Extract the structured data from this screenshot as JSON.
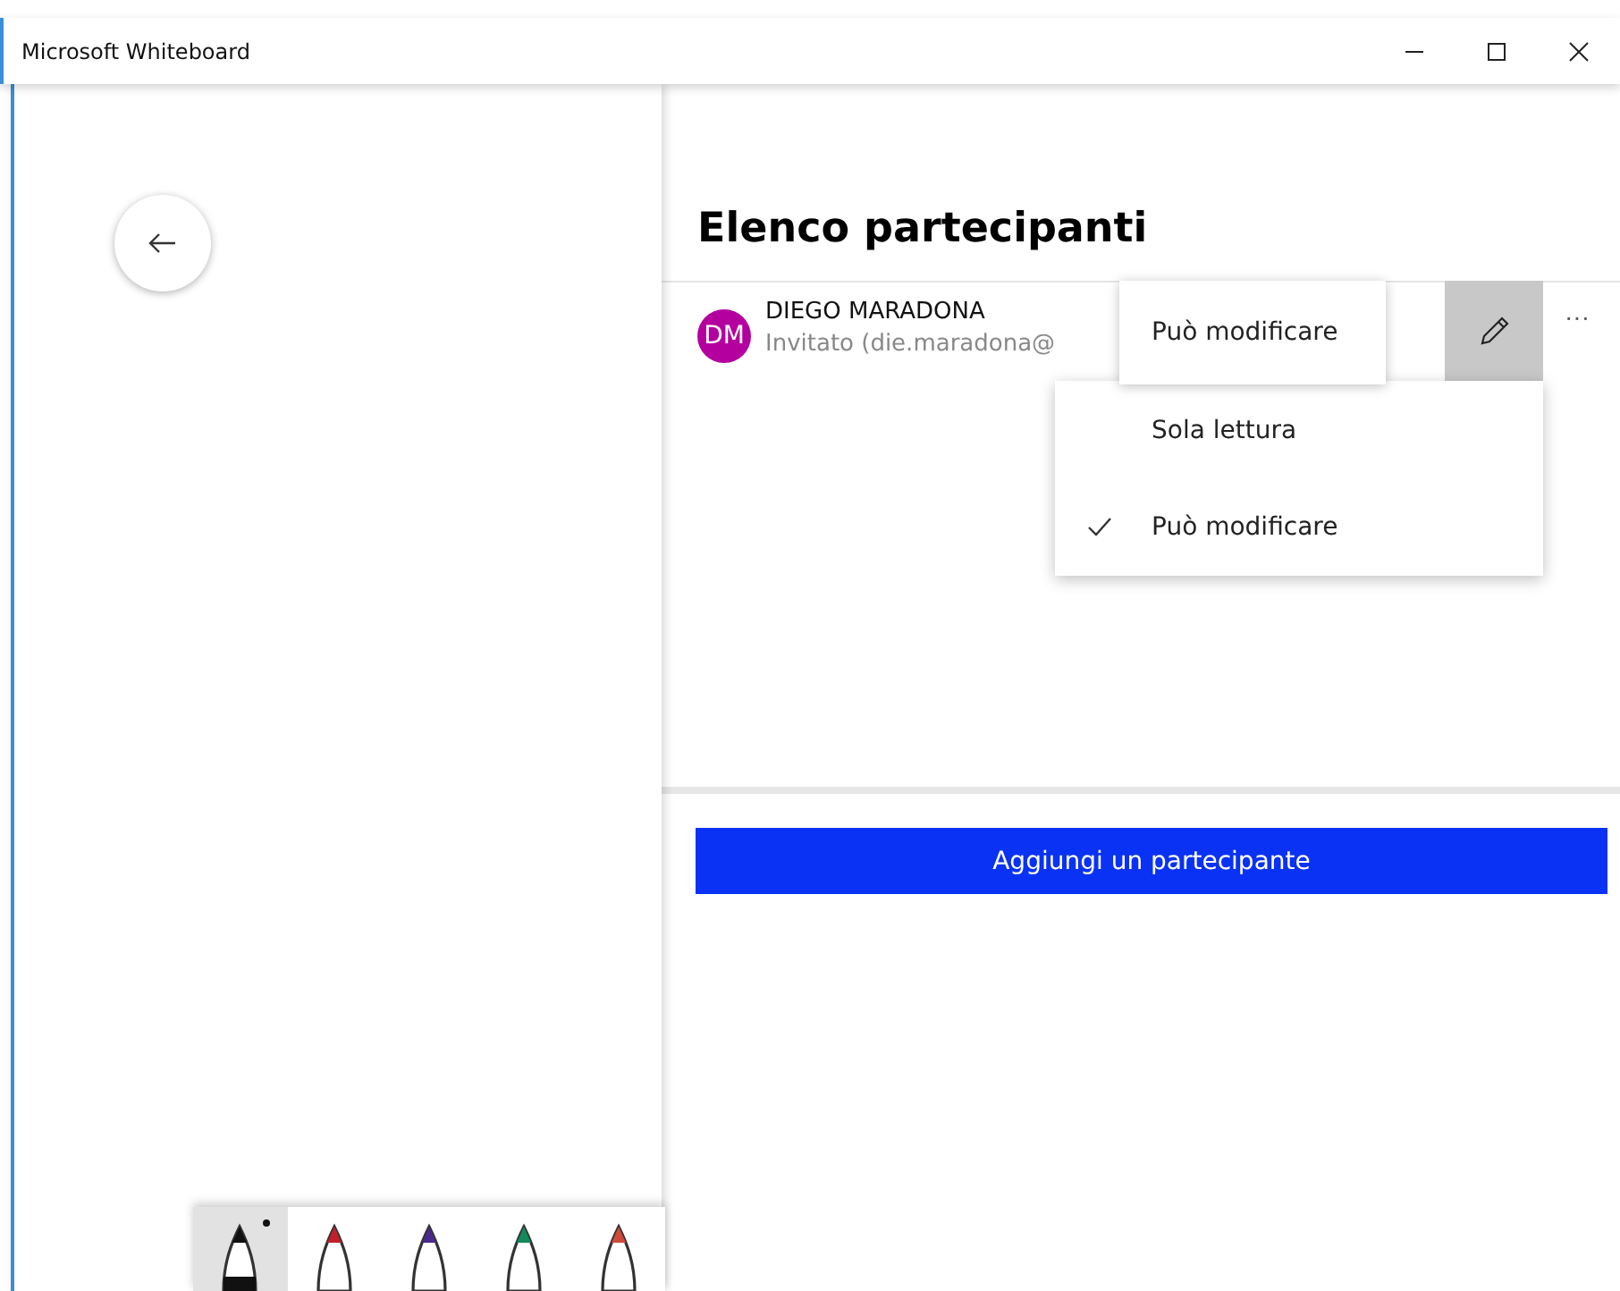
{
  "window": {
    "title": "Microsoft Whiteboard",
    "controls": [
      {
        "kind": "minimize"
      },
      {
        "kind": "maximize"
      },
      {
        "kind": "close"
      }
    ]
  },
  "panel": {
    "title": "Elenco partecipanti",
    "participants": [
      {
        "initials": "DM",
        "name": "DIEGO MARADONA",
        "status": "Invitato (die.maradona@",
        "color": "#b4009e"
      }
    ],
    "more": "···",
    "tooltip": "Può modificare",
    "menu": [
      {
        "label": "Sola lettura",
        "selected": false
      },
      {
        "label": "Può modificare",
        "selected": true
      }
    ],
    "add_button": "Aggiungi un partecipante"
  },
  "pens": [
    {
      "color": "#111111",
      "selected": true
    },
    {
      "color": "#c0202a",
      "selected": false
    },
    {
      "color": "#4a2a8a",
      "selected": false
    },
    {
      "color": "#128a5a",
      "selected": false
    },
    {
      "color": "#d04a3a",
      "selected": false
    }
  ]
}
